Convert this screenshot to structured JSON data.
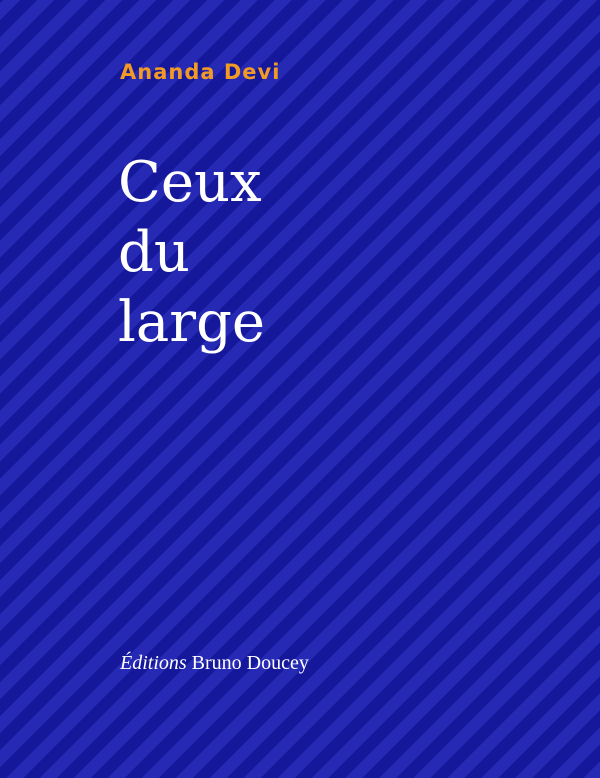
{
  "cover": {
    "author": "Ananda Devi",
    "title_lines": [
      "Ceux",
      "du",
      "large"
    ],
    "publisher_prefix": "Éditions",
    "publisher_name": "Bruno Doucey",
    "colors": {
      "background": "#1f22a8",
      "stripe_light": "#2629b4",
      "stripe_dark": "#15189a",
      "author": "#f29a26",
      "title": "#ffffff"
    }
  }
}
